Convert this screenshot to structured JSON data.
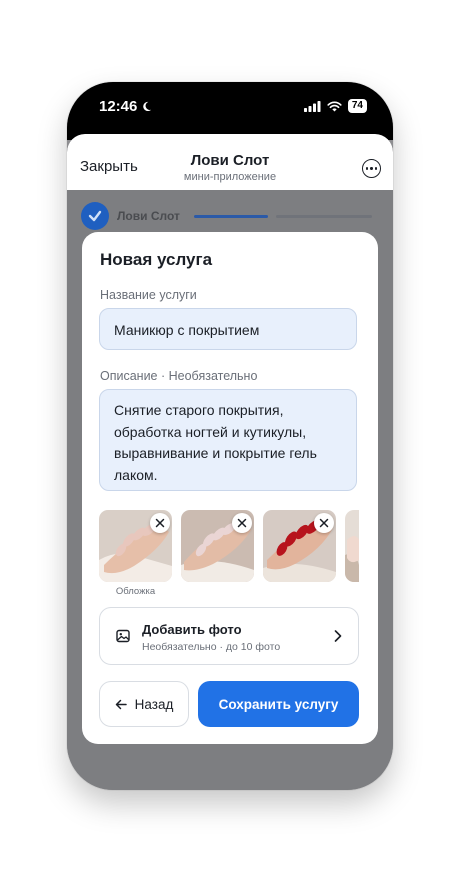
{
  "status_bar": {
    "time": "12:46",
    "battery": "74"
  },
  "header": {
    "close_label": "Закрыть",
    "title": "Лови Слот",
    "subtitle": "мини-приложение"
  },
  "background": {
    "app_name": "Лови Слот"
  },
  "form": {
    "title": "Новая услуга",
    "name_label": "Название услуги",
    "name_value": "Маникюр с покрытием",
    "description_label": "Описание · Необязательно",
    "description_value": "Снятие старого покрытия, обработка ногтей и кутикулы, выравнивание и покрытие гель лаком.",
    "photos": [
      {
        "nail_color": "#e8c7bd",
        "remove_icon": "close-icon"
      },
      {
        "nail_color": "#ead5d4",
        "remove_icon": "close-icon"
      },
      {
        "nail_color": "#b7141d",
        "remove_icon": "close-icon"
      },
      {
        "nail_color": "#f0d9cf",
        "remove_icon": "close-icon"
      }
    ],
    "cover_label": "Обложка",
    "add_photo": {
      "title": "Добавить фото",
      "subtitle": "Необязательно · до 10 фото",
      "icon": "image-icon"
    },
    "back_label": "Назад",
    "save_label": "Сохранить услугу"
  },
  "colors": {
    "accent": "#2172e6",
    "input_bg": "#e8f0fc",
    "overlay": "#7d7e81"
  }
}
